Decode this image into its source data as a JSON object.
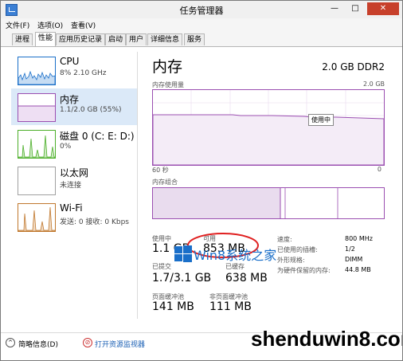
{
  "window": {
    "title": "任务管理器",
    "minimize": "—",
    "maximize": "□",
    "close": "✕"
  },
  "menu": [
    "文件(F)",
    "选项(O)",
    "查看(V)"
  ],
  "tabs": [
    "进程",
    "性能",
    "应用历史记录",
    "启动",
    "用户",
    "详细信息",
    "服务"
  ],
  "active_tab": "性能",
  "sidebar": [
    {
      "name": "CPU",
      "sub": "8% 2.10 GHz",
      "color": "#1a6fc9"
    },
    {
      "name": "内存",
      "sub": "1.1/2.0 GB (55%)",
      "color": "#9b4fb1"
    },
    {
      "name": "磁盘 0 (C: E: D:)",
      "sub": "0%",
      "color": "#4caf2a"
    },
    {
      "name": "以太网",
      "sub": "未连接",
      "color": "#a0a0a0"
    },
    {
      "name": "Wi-Fi",
      "sub": "发送: 0 接收: 0 Kbps",
      "color": "#c0782e"
    }
  ],
  "main": {
    "title": "内存",
    "spec": "2.0 GB DDR2",
    "usage_label": "内存使用量",
    "usage_max": "2.0 GB",
    "tooltip": "使用中",
    "time_left": "60 秒",
    "time_right": "0",
    "composition_label": "内存组合",
    "composition_in_use_fraction": 0.55,
    "stats": [
      {
        "label": "使用中",
        "value": "1.1 GB"
      },
      {
        "label": "可用",
        "value": "853 MB"
      },
      {
        "label": "已提交",
        "value": "1.7/3.1 GB"
      },
      {
        "label": "已缓存",
        "value": "638 MB"
      },
      {
        "label": "页面缓冲池",
        "value": "141 MB"
      },
      {
        "label": "非页面缓冲池",
        "value": "111 MB"
      }
    ],
    "props": [
      {
        "label": "速度:",
        "value": "800 MHz"
      },
      {
        "label": "已使用的插槽:",
        "value": "1/2"
      },
      {
        "label": "外形规格:",
        "value": "DIMM"
      },
      {
        "label": "为硬件保留的内存:",
        "value": "44.8 MB"
      }
    ]
  },
  "bottom": {
    "fewer_details": "简略信息(D)",
    "resource_monitor": "打开资源监视器"
  },
  "watermark": {
    "text": "Win8系统之家",
    "site": "shenduwin8.com"
  }
}
